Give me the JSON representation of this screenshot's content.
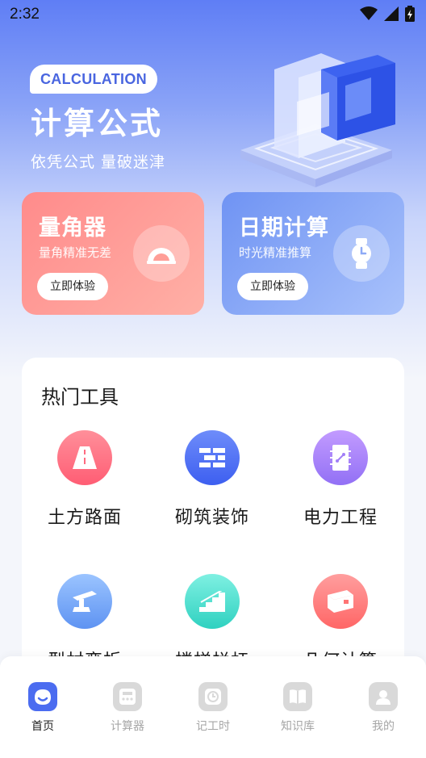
{
  "status_bar": {
    "time": "2:32"
  },
  "hero": {
    "badge": "CALCULATION",
    "title": "计算公式",
    "subtitle": "依凭公式  量破迷津"
  },
  "cards": [
    {
      "title": "量角器",
      "desc": "量角精准无差",
      "button": "立即体验",
      "icon": "protractor-icon"
    },
    {
      "title": "日期计算",
      "desc": "时光精准推算",
      "button": "立即体验",
      "icon": "watch-icon"
    }
  ],
  "hot_tools": {
    "title": "热门工具",
    "items": [
      {
        "label": "土方路面",
        "icon": "road-icon"
      },
      {
        "label": "砌筑装饰",
        "icon": "brick-wall-icon"
      },
      {
        "label": "电力工程",
        "icon": "circuit-board-icon"
      },
      {
        "label": "型材弯折",
        "icon": "steel-bend-icon"
      },
      {
        "label": "楼梯栏杆",
        "icon": "stair-railing-icon"
      },
      {
        "label": "几何计算",
        "icon": "geometry-box-icon"
      }
    ]
  },
  "tabbar": {
    "items": [
      {
        "label": "首页",
        "icon": "home-icon",
        "active": true
      },
      {
        "label": "计算器",
        "icon": "calculator-icon",
        "active": false
      },
      {
        "label": "记工时",
        "icon": "clock-icon",
        "active": false
      },
      {
        "label": "知识库",
        "icon": "book-icon",
        "active": false
      },
      {
        "label": "我的",
        "icon": "profile-icon",
        "active": false
      }
    ]
  },
  "colors": {
    "accent": "#4b6cf0",
    "card_left": "#ff8b8b",
    "card_right": "#6f93f3"
  }
}
